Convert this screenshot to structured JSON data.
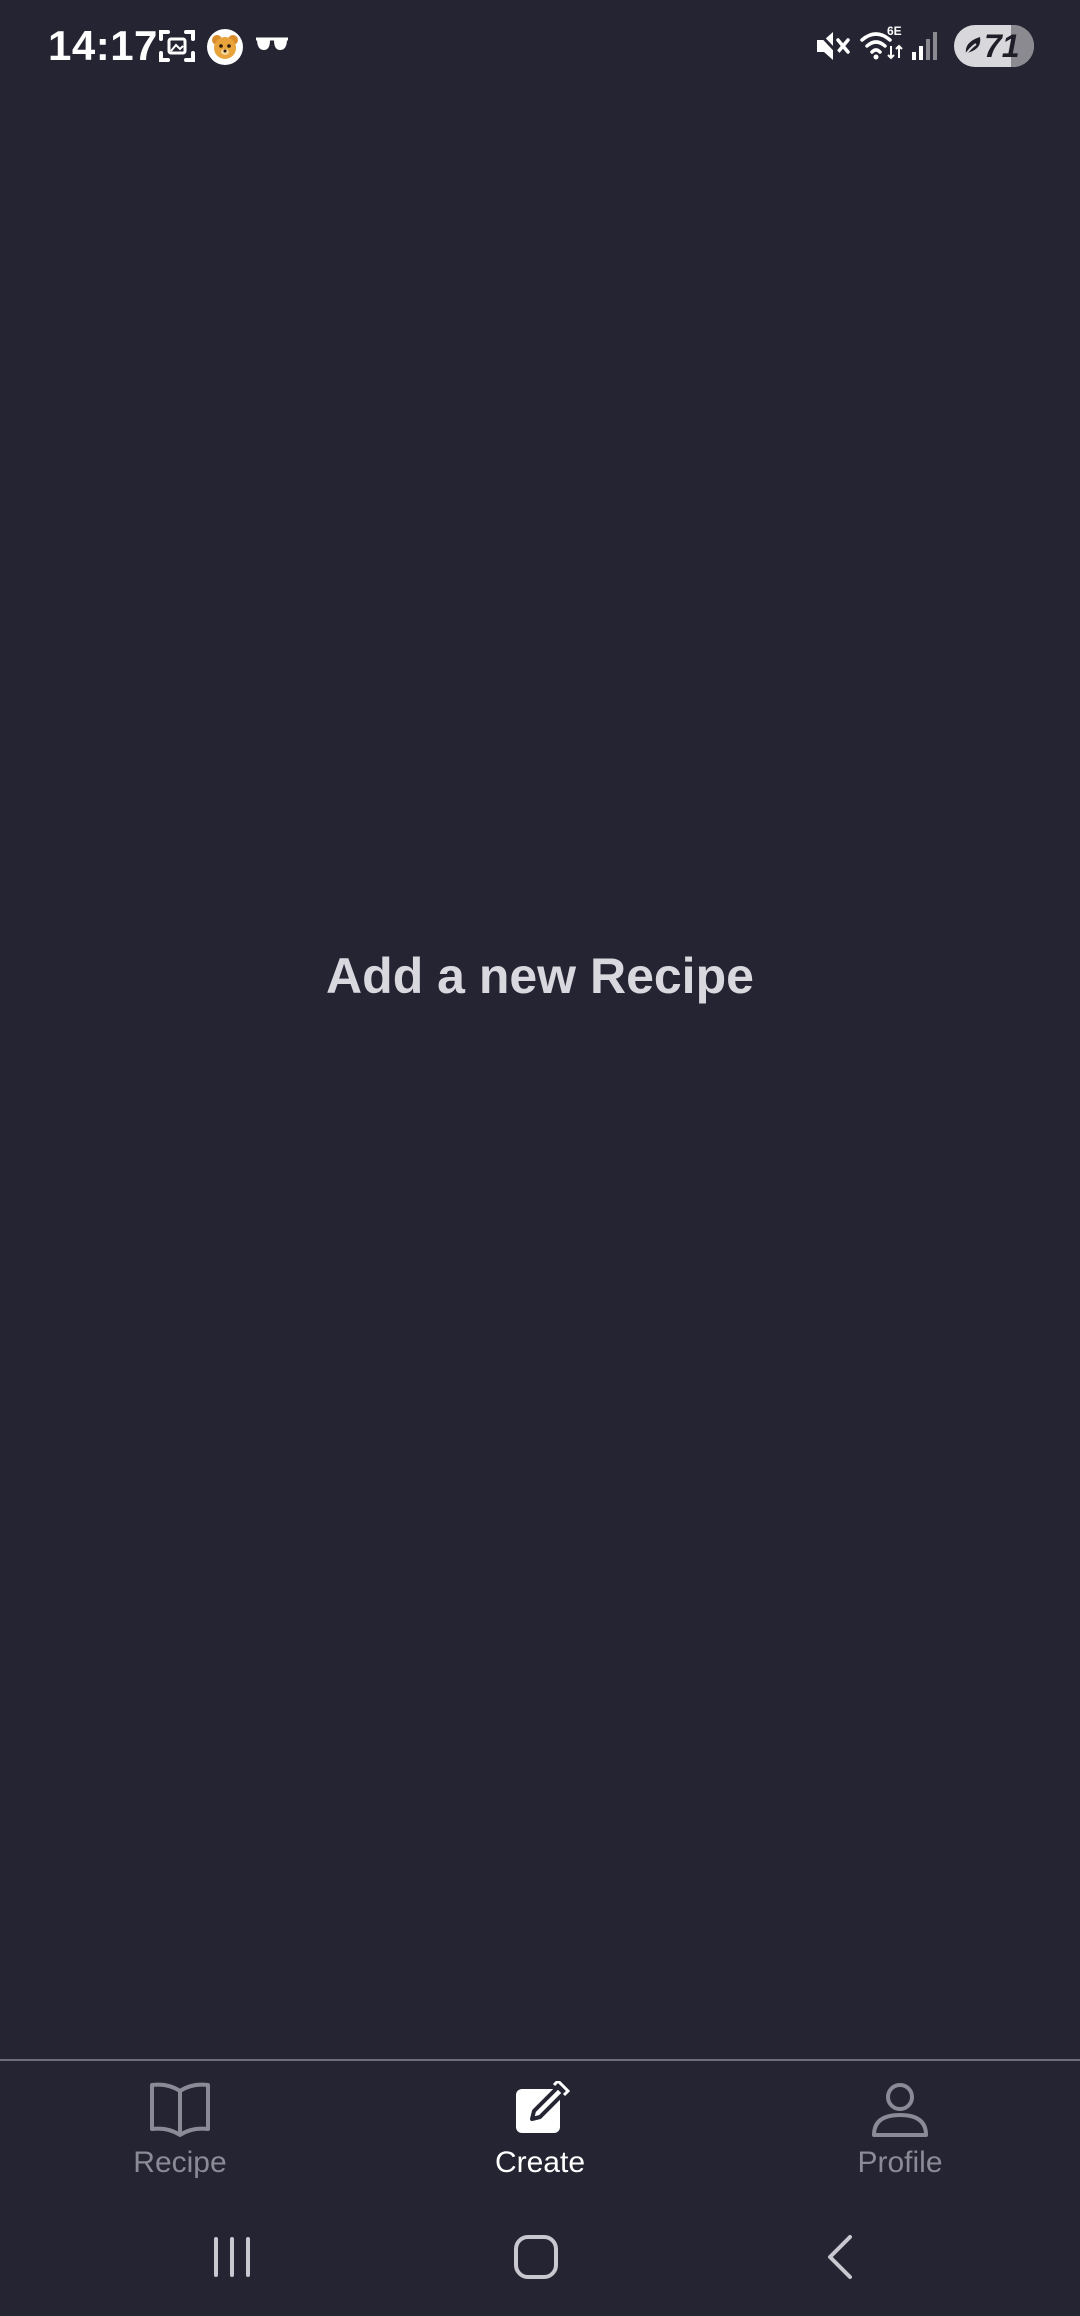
{
  "status_bar": {
    "time": "14:17",
    "battery": "71",
    "battery_level_percent": 71,
    "left_icons": [
      "screenshot-icon",
      "bear-app-icon",
      "glasses-icon"
    ],
    "right_icons": [
      "mute-icon",
      "wifi-6e-icon",
      "signal-icon",
      "battery-saver-icon"
    ]
  },
  "main": {
    "title": "Add a new Recipe"
  },
  "bottom_nav": {
    "items": [
      {
        "label": "Recipe",
        "icon": "book-icon",
        "active": false
      },
      {
        "label": "Create",
        "icon": "edit-icon",
        "active": true
      },
      {
        "label": "Profile",
        "icon": "person-icon",
        "active": false
      }
    ]
  },
  "system_nav": {
    "buttons": [
      "recents-button",
      "home-button",
      "back-button"
    ]
  },
  "colors": {
    "background": "#252432",
    "title_text": "#d9d8df",
    "nav_inactive": "#8b8a97",
    "nav_active": "#ffffff",
    "divider": "#6e6d7a"
  }
}
